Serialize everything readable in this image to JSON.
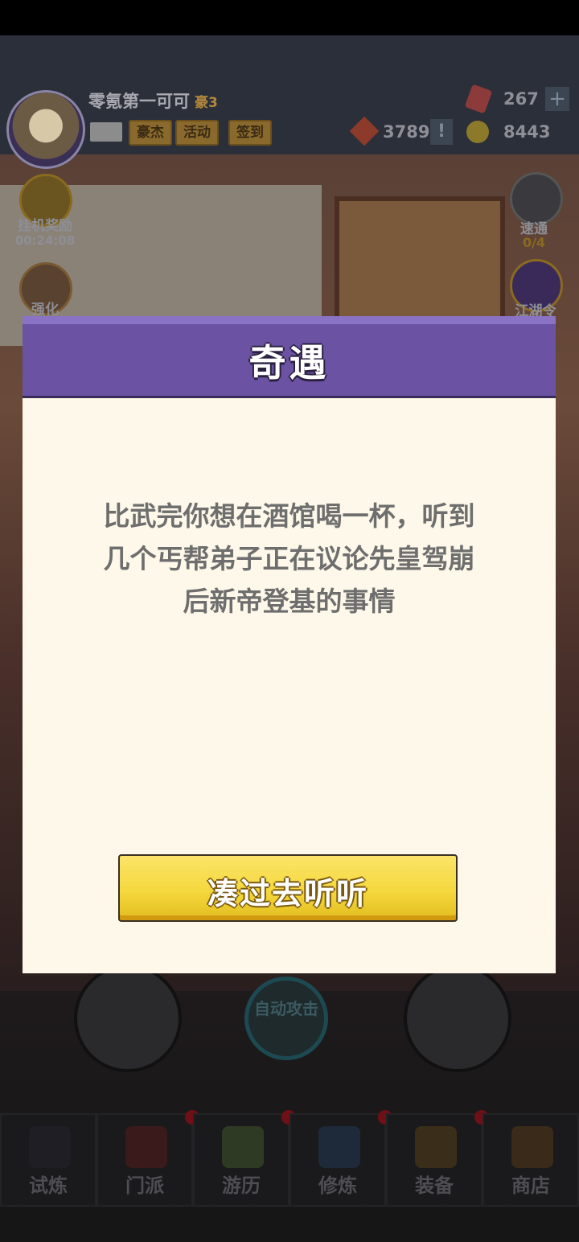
{
  "header": {
    "player_name": "零氪第一可可",
    "vip_label": "豪3",
    "buttons": [
      "豪杰",
      "活动",
      "签到"
    ],
    "gems": "267",
    "gems_plus": "+",
    "tokens": "3789",
    "alert": "!",
    "coins": "8443"
  },
  "side_left": [
    {
      "label": "挂机奖励",
      "sub": "00:24:08"
    },
    {
      "label": "强化"
    }
  ],
  "side_right": [
    {
      "label": "速通",
      "sub": "0/4"
    },
    {
      "label": "江湖令"
    }
  ],
  "controls": {
    "auto_attack": "自动攻击"
  },
  "bottom_nav": [
    {
      "label": "试炼",
      "icon": "ninja-icon"
    },
    {
      "label": "门派",
      "icon": "temple-icon"
    },
    {
      "label": "游历",
      "icon": "landscape-icon"
    },
    {
      "label": "修炼",
      "icon": "scroll-book-icon"
    },
    {
      "label": "装备",
      "icon": "sword-icon"
    },
    {
      "label": "商店",
      "icon": "shop-icon"
    }
  ],
  "dialog": {
    "title": "奇遇",
    "body_lines": [
      "比武完你想在酒馆喝一杯，听到",
      "几个丐帮弟子正在议论先皇驾崩",
      "后新帝登基的事情"
    ],
    "action_label": "凑过去听听"
  },
  "colors": {
    "dialog_header": "#6b52a3",
    "dialog_body": "#fdf8e9",
    "action_button": "#f5d83e"
  }
}
